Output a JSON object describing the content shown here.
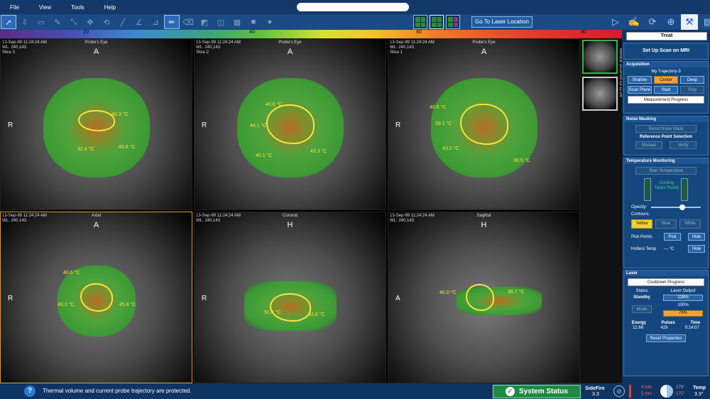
{
  "menu": {
    "file": "File",
    "view": "View",
    "tools": "Tools",
    "help": "Help"
  },
  "toolbar": {
    "goto_laser": "Go To Laser Location"
  },
  "colorbar": {
    "ticks": [
      "20",
      "40",
      "60",
      "80"
    ]
  },
  "panes": {
    "p1": {
      "info": "13-Sep-99 11:24:24 AM\nWL: 240,143\nSlice 3",
      "title": "Probe's Eye",
      "top": "A",
      "left": "R",
      "t1": "40.3 °C",
      "t2": "42.4 °C",
      "t3": "45.8 °C"
    },
    "p2": {
      "info": "13-Sep-99 11:24:24 AM\nWL: 240,143\nSlice 2",
      "title": "Probe's Eye",
      "top": "A",
      "left": "R",
      "t1": "40.0 °C",
      "t2": "44.1 °C",
      "t3": "40.1 °C",
      "t4": "43.3 °C"
    },
    "p3": {
      "info": "13-Sep-99 11:24:24 AM\nWL: 240,143\nSlice 1",
      "title": "Probe's Eye",
      "top": "A",
      "left": "R",
      "t1": "40.6 °C",
      "t2": "39.1 °C",
      "t3": "43.2 °C",
      "t4": "38.5 °C"
    },
    "p4": {
      "info": "13-Sep-99 11:24:24 AM\nWL: 240,143",
      "title": "Axial",
      "top": "A",
      "left": "R",
      "t1": "40.6 °C",
      "t2": "43.2 °C",
      "t3": "45.8 °C"
    },
    "p5": {
      "info": "13-Sep-99 11:24:24 AM\nWL: 240,143",
      "title": "Coronal",
      "top": "H",
      "left": "R",
      "t1": "51.4 °C",
      "t2": "43.8 °C"
    },
    "p6": {
      "info": "13-Sep-99 11:24:24 AM\nWL: 240,143",
      "title": "Sagittal",
      "top": "H",
      "left": "A",
      "t1": "40.0 °C",
      "t2": "38.7 °C"
    }
  },
  "thumbs": {
    "label": "Monitor 2019-09-13 11:24"
  },
  "panel": {
    "treat": "Treat",
    "setup_scan": "Set Up Scan on MRI",
    "acquisition": {
      "title": "Acquisition",
      "trajectory": "My Trajectory-3",
      "shallow": "Shallow",
      "center": "Center",
      "deep": "Deep",
      "scan_plane": "Scan Plane",
      "start": "Start",
      "stop": "Stop",
      "progress": "Measurement Progress"
    },
    "noise": {
      "title": "Noise Masking",
      "reset": "Reset Noise Mask",
      "ref_title": "Reference Point Selection",
      "manual": "Manual",
      "verify": "Verify"
    },
    "temp": {
      "title": "Temperature Monitoring",
      "start": "Start Temperature",
      "cooling": "Cooling Tanks Ready",
      "opacity": "Opacity:",
      "contours": "Contours:",
      "yellow": "Yellow",
      "blue": "Blue",
      "white": "White",
      "pick_points": "Pick Points",
      "pick": "Pick",
      "hide": "Hide",
      "hottest": "Hottest Temp",
      "hottest_val": "--- °C",
      "hide2": "Hide"
    },
    "laser": {
      "title": "Laser",
      "cooldown": "Cooldown Progress",
      "status_lbl": "Status",
      "output_lbl": "Laser Output",
      "status": "Standby",
      "out1": "128%",
      "out2": "100%",
      "out3": "78%",
      "mode": "Mode",
      "energy_lbl": "Energy",
      "pulses_lbl": "Pulses",
      "time_lbl": "Time",
      "energy": "12.66",
      "pulses": "429",
      "time": "0:14:07",
      "reset": "Reset Properties"
    }
  },
  "bottom": {
    "message": "Thermal volume and current probe trajectory are protected.",
    "status": "System Status",
    "sidefire": "SideFire",
    "sidefire_val": "3.3",
    "mm1": "4 mm",
    "mm2": "5 mm",
    "deg1": "175°",
    "deg2": "175°",
    "temp_lbl": "Temp",
    "temp_val": "3.3°"
  }
}
